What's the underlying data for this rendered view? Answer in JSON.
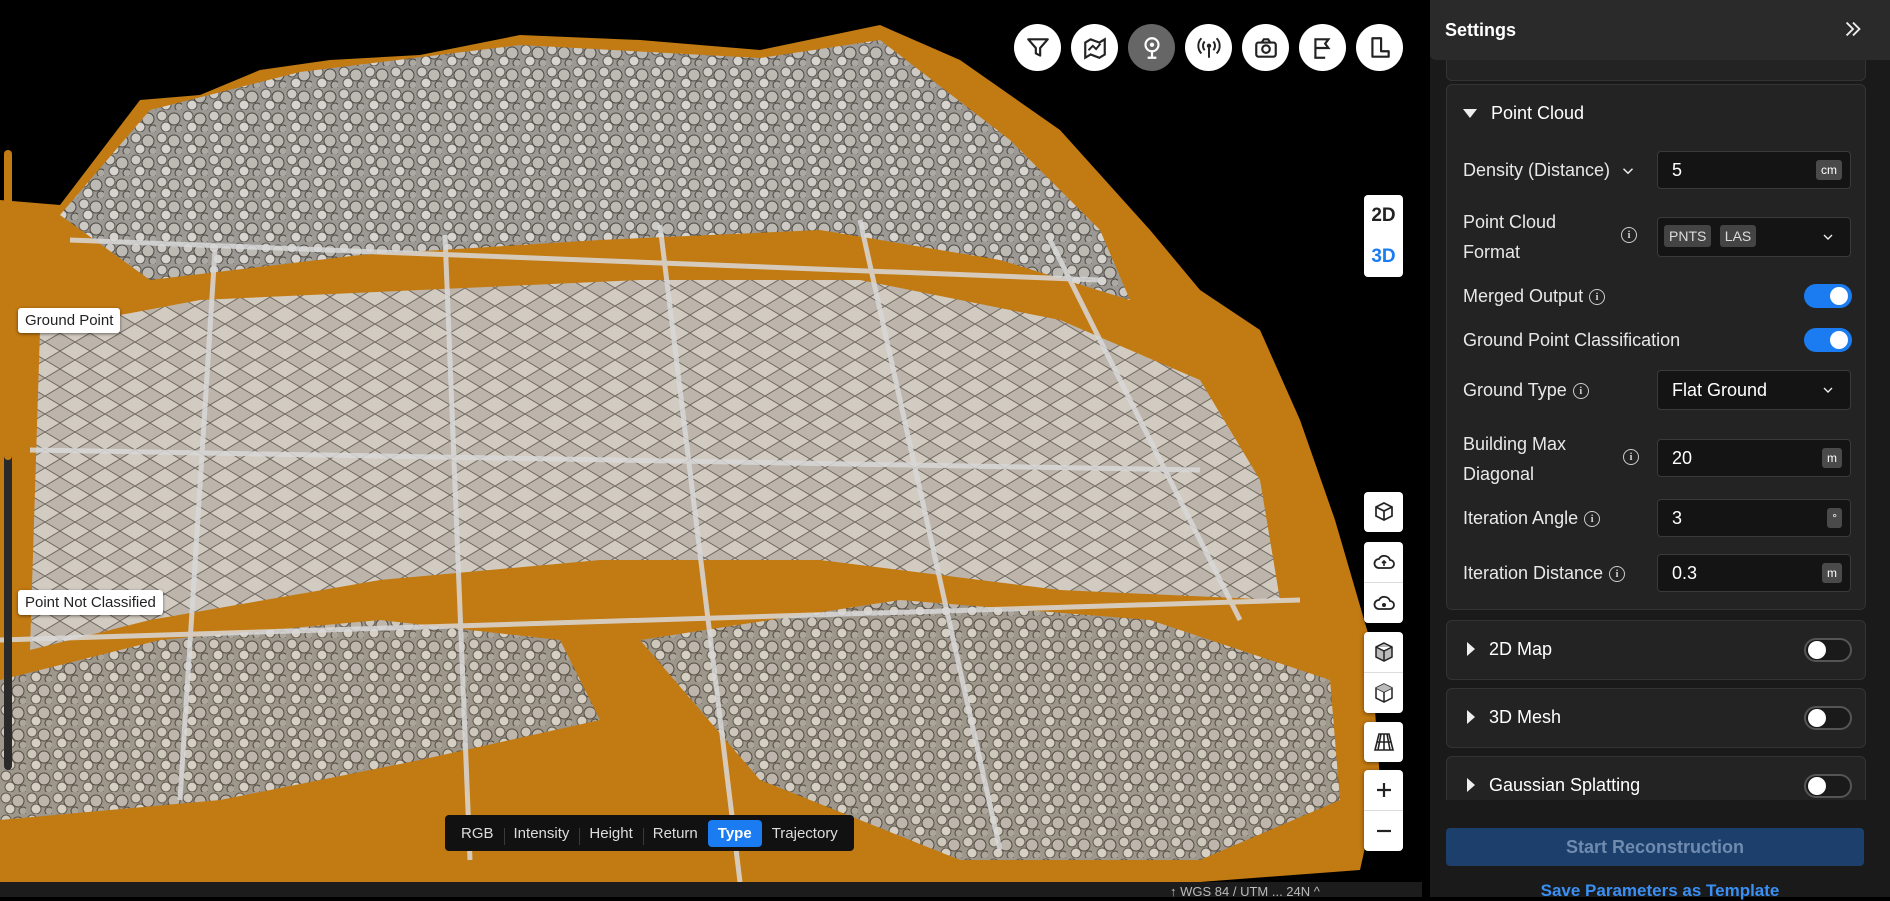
{
  "viewport": {
    "labels": {
      "ground_point": "Ground Point",
      "not_classified": "Point Not Classified"
    },
    "toolbar_icons": [
      "filter-icon",
      "map-layers-icon",
      "pin-icon",
      "antenna-icon",
      "camera-icon",
      "flag-icon",
      "measure-icon"
    ],
    "dim_toggle": {
      "d2": "2D",
      "d3": "3D",
      "active": "3D"
    },
    "color_modes": [
      "RGB",
      "Intensity",
      "Height",
      "Return",
      "Type",
      "Trajectory"
    ],
    "active_color_mode": "Type",
    "status": "↑ WGS 84 / UTM ... 24N  ^",
    "colors": {
      "ground": "#c27a12",
      "accent": "#1a7cf0"
    }
  },
  "settings": {
    "title": "Settings",
    "point_cloud": {
      "title": "Point Cloud",
      "density_label": "Density (Distance)",
      "density_value": "5",
      "density_unit": "cm",
      "format_label_1": "Point Cloud",
      "format_label_2": "Format",
      "format_tags": [
        "PNTS",
        "LAS"
      ],
      "merged_label": "Merged Output",
      "merged_on": true,
      "ground_class_label": "Ground Point Classification",
      "ground_class_on": true,
      "ground_type_label": "Ground Type",
      "ground_type_value": "Flat Ground",
      "building_label_1": "Building Max",
      "building_label_2": "Diagonal",
      "building_value": "20",
      "building_unit": "m",
      "iter_angle_label": "Iteration Angle",
      "iter_angle_value": "3",
      "iter_angle_unit": "°",
      "iter_dist_label": "Iteration Distance",
      "iter_dist_value": "0.3",
      "iter_dist_unit": "m"
    },
    "map2d": {
      "title": "2D Map",
      "on": false
    },
    "mesh3d": {
      "title": "3D Mesh",
      "on": false
    },
    "gaussian": {
      "title": "Gaussian Splatting",
      "on": false
    },
    "start_label": "Start Reconstruction",
    "save_label": "Save Parameters as Template"
  }
}
